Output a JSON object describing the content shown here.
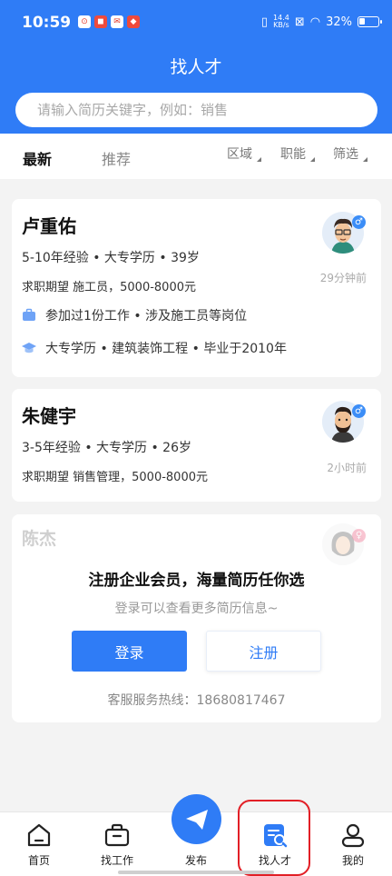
{
  "status_bar": {
    "time": "10:59",
    "net_speed_value": "14.4",
    "net_speed_unit": "KB/s",
    "battery": "32%"
  },
  "header": {
    "title": "找人才",
    "search_placeholder": "请输入简历关键字，例如：销售"
  },
  "tabs": {
    "latest": "最新",
    "recommend": "推荐"
  },
  "filters": {
    "region": "区域",
    "position": "职能",
    "filter": "筛选"
  },
  "candidates": [
    {
      "name": "卢重佑",
      "meta": "5-10年经验 • 大专学历 • 39岁",
      "expect": "求职期望 施工员，5000-8000元",
      "time": "29分钟前",
      "work": "参加过1份工作 • 涉及施工员等岗位",
      "edu": "大专学历 • 建筑装饰工程 • 毕业于2010年",
      "gender": "♂"
    },
    {
      "name": "朱健宇",
      "meta": "3-5年经验 • 大专学历 • 26岁",
      "expect": "求职期望 销售管理，5000-8000元",
      "time": "2小时前",
      "gender": "♂"
    },
    {
      "name": "陈杰",
      "gender": "♀"
    }
  ],
  "lock": {
    "title": "注册企业会员，海量简历任你选",
    "subtitle": "登录可以查看更多简历信息~",
    "login": "登录",
    "register": "注册",
    "hotline": "客服服务热线：18680817467"
  },
  "tabbar": {
    "home": "首页",
    "jobs": "找工作",
    "publish": "发布",
    "talent": "找人才",
    "mine": "我的"
  },
  "colors": {
    "brand": "#2f7cf6",
    "highlight": "#e21f26"
  }
}
